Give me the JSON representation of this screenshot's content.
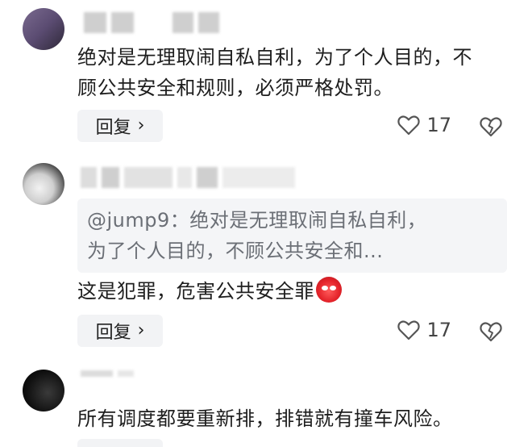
{
  "comments": [
    {
      "text_line1": "绝对是无理取闹自私自利，为了个人目的，不",
      "text_line2": "顾公共安全和规则，必须严格处罚。",
      "reply_label": "回复",
      "reply_chevron": "›",
      "likes": "17"
    },
    {
      "quote_line1": "@jump9：绝对是无理取闹自私自利，",
      "quote_line2": "为了个人目的，不顾公共安全和...",
      "text": "这是犯罪，危害公共安全罪",
      "emoji_icon": "angry-face-icon",
      "reply_label": "回复",
      "reply_chevron": "›",
      "likes": "17"
    },
    {
      "text": "所有调度都要重新排，排错就有撞车风险。"
    }
  ],
  "colors": {
    "background": "#ffffff",
    "text": "#1e1e1e",
    "quote_bg": "#f4f5f7",
    "quote_text": "#6b6f76",
    "button_bg": "#f2f3f5",
    "emoji_red": "#e4232a"
  }
}
